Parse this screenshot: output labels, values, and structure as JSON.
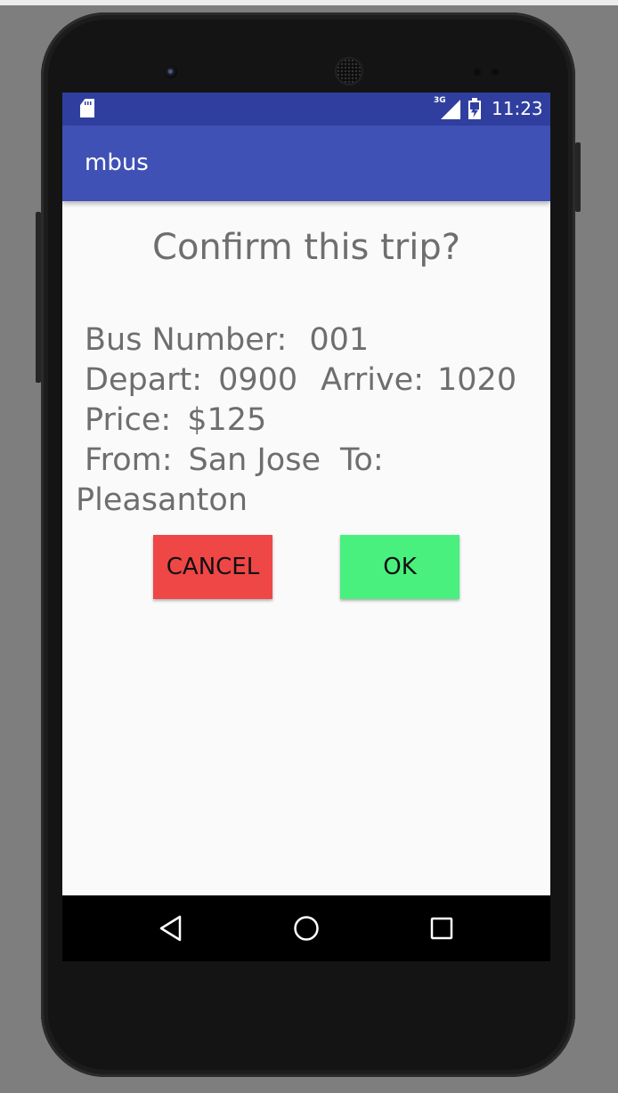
{
  "status_bar": {
    "network_label": "3G",
    "time": "11:23"
  },
  "app_bar": {
    "title": "mbus"
  },
  "dialog": {
    "title": "Confirm this trip?",
    "bus_number_label": "Bus Number:",
    "bus_number": "001",
    "depart_label": "Depart:",
    "depart": "0900",
    "arrive_label": "Arrive:",
    "arrive": "1020",
    "price_label": "Price:",
    "price": "$125",
    "from_label": "From:",
    "from": "San Jose",
    "to_label": "To:",
    "to": "Pleasanton",
    "cancel_label": "CANCEL",
    "ok_label": "OK",
    "cancel_color": "#ef4646",
    "ok_color": "#49f07e"
  },
  "nav_bar": {
    "icons": [
      "back-icon",
      "home-icon",
      "recents-icon"
    ]
  },
  "colors": {
    "status_bar": "#303f9f",
    "app_bar": "#3f51b5",
    "background": "#fafafa",
    "text": "#6e6e6e"
  }
}
